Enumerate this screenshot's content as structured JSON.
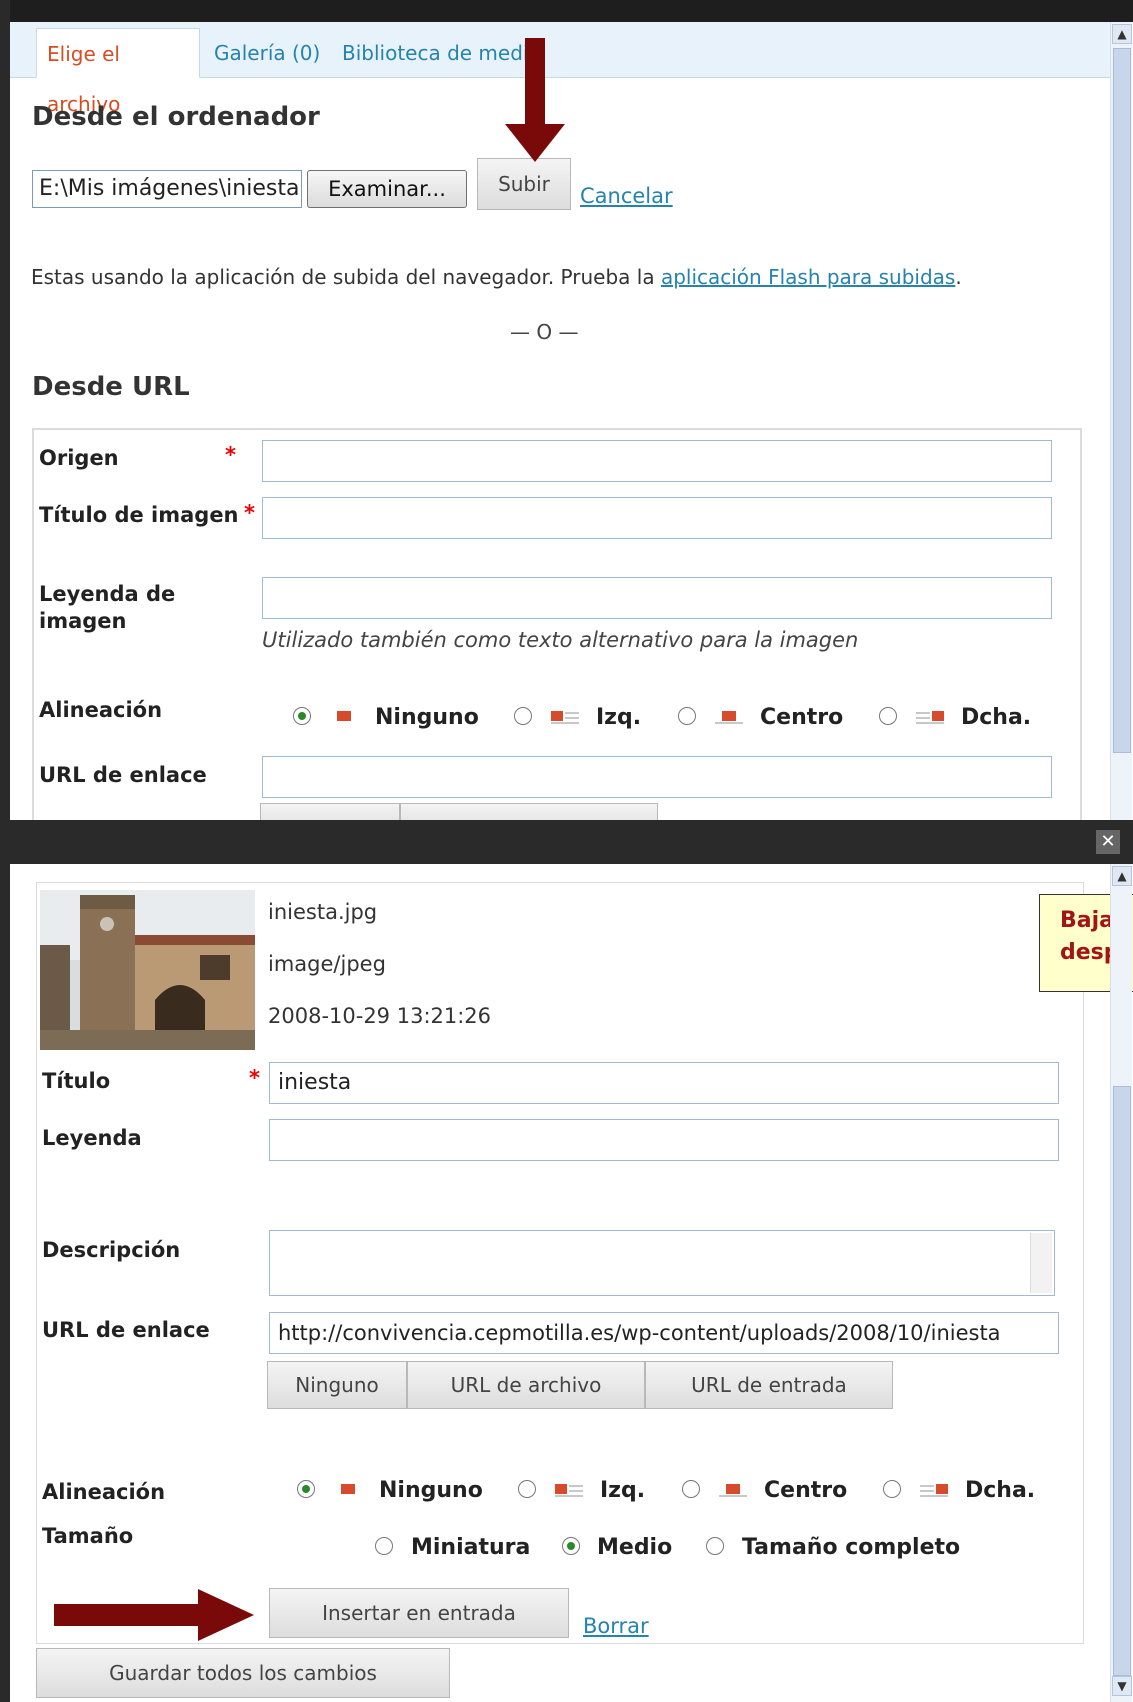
{
  "top": {
    "tabs": [
      "Elige el archivo",
      "Galería (0)",
      "Biblioteca de medi"
    ],
    "from_computer_heading": "Desde el ordenador",
    "file_path": "E:\\Mis imágenes\\iniesta",
    "browse_label": "Examinar...",
    "upload_label": "Subir",
    "cancel_label": "Cancelar",
    "notice_text": "Estas usando la aplicación de subida del navegador. Prueba la ",
    "notice_link": "aplicación Flash para subidas",
    "notice_end": ".",
    "or_text": "— O —",
    "from_url_heading": "Desde URL",
    "fields": {
      "origen": "Origen",
      "titulo_imagen": "Título de imagen",
      "leyenda_imagen_1": "Leyenda de",
      "leyenda_imagen_2": "imagen",
      "leyenda_help": "Utilizado también como texto alternativo para la imagen",
      "alineacion": "Alineación",
      "url_enlace": "URL de enlace"
    },
    "required_mark": "*",
    "alignment_options": [
      "Ninguno",
      "Izq.",
      "Centro",
      "Dcha."
    ],
    "alignment_selected": "Ninguno"
  },
  "bottom": {
    "file_name": "iniesta.jpg",
    "mime_type": "image/jpeg",
    "date": "2008-10-29 13:21:26",
    "tip_line1": "Bajar",
    "tip_line2": "despl",
    "labels": {
      "titulo": "Título",
      "leyenda": "Leyenda",
      "descripcion": "Descripción",
      "url_enlace": "URL de enlace",
      "alineacion": "Alineación",
      "tamano": "Tamaño"
    },
    "required_mark": "*",
    "title_value": "iniesta",
    "link_url_value": "http://convivencia.cepmotilla.es/wp-content/uploads/2008/10/iniesta",
    "link_buttons": [
      "Ninguno",
      "URL de archivo",
      "URL de entrada"
    ],
    "alignment_options": [
      "Ninguno",
      "Izq.",
      "Centro",
      "Dcha."
    ],
    "alignment_selected": "Ninguno",
    "size_options": [
      "Miniatura",
      "Medio",
      "Tamaño completo"
    ],
    "size_selected": "Medio",
    "insert_label": "Insertar en entrada",
    "delete_label": "Borrar",
    "save_all_label": "Guardar todos los cambios"
  },
  "colors": {
    "arrow": "#7a0a0a",
    "link": "#2583ad",
    "active_tab": "#d54e21",
    "required": "#e00000",
    "tip_text": "#a31515",
    "tip_bg": "#ffffcc"
  }
}
